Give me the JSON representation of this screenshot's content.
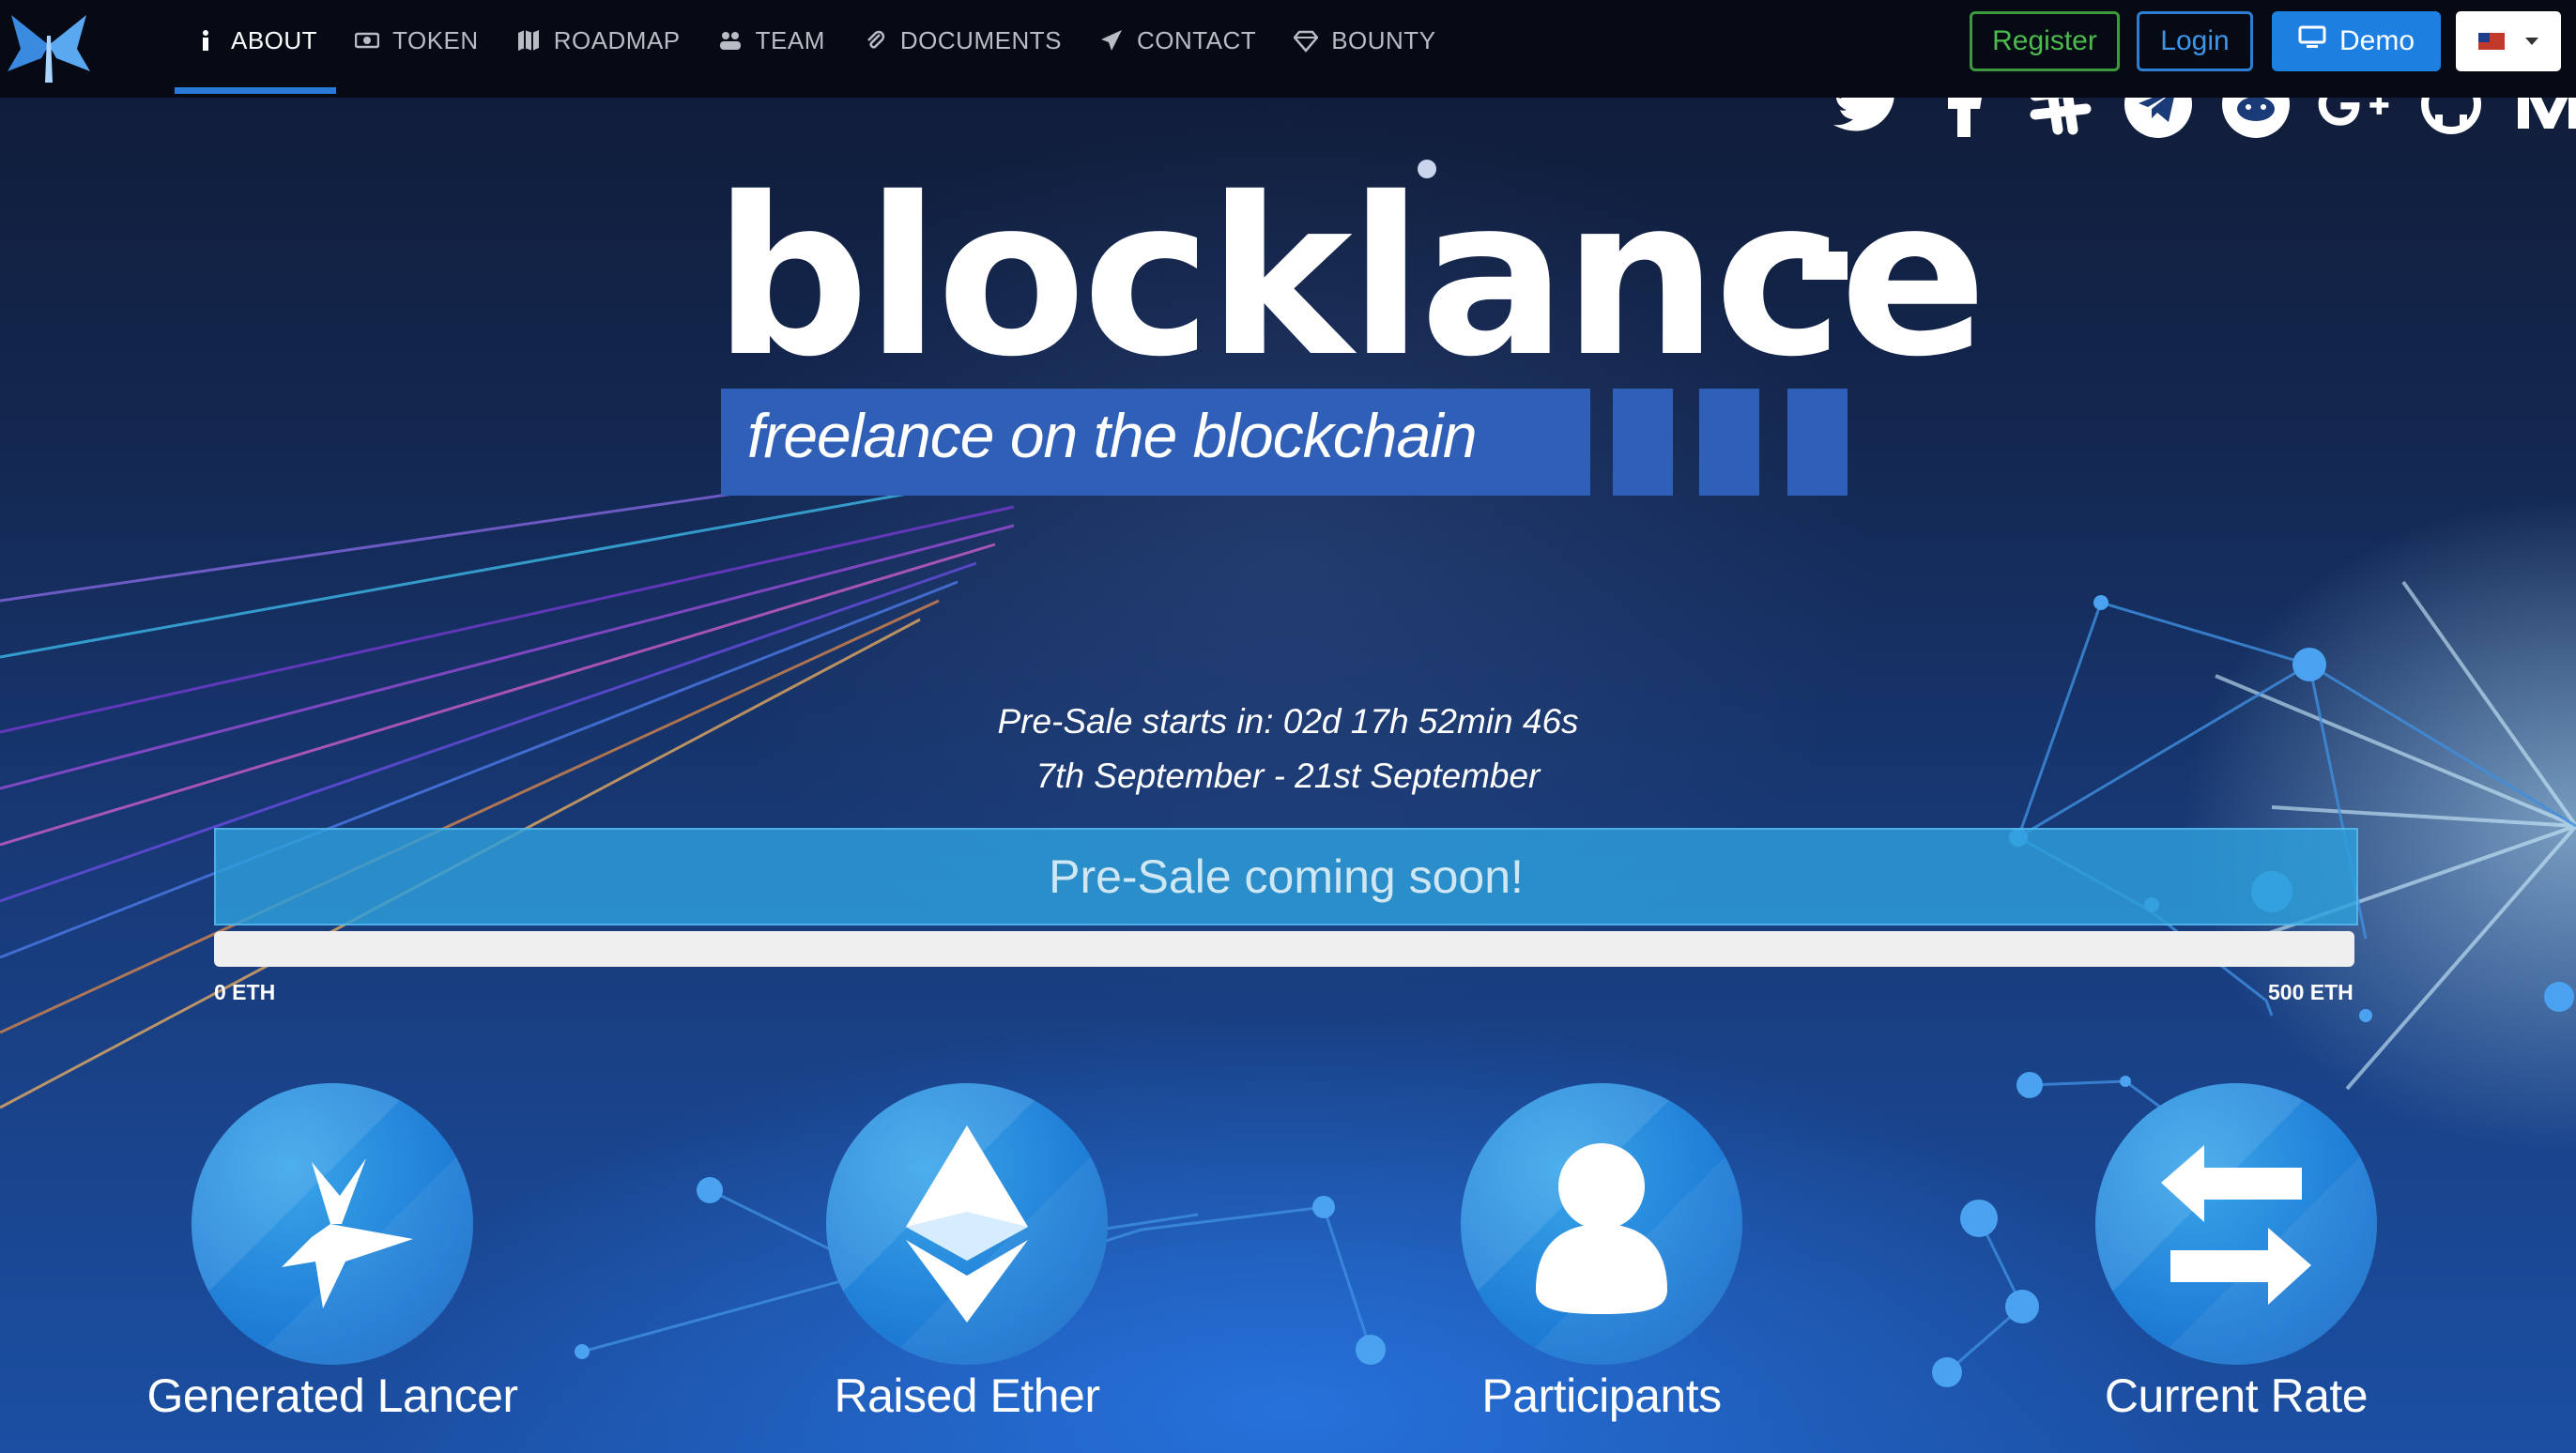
{
  "nav": {
    "items": [
      {
        "label": "ABOUT",
        "icon": "info-icon",
        "active": true
      },
      {
        "label": "TOKEN",
        "icon": "money-icon",
        "active": false
      },
      {
        "label": "ROADMAP",
        "icon": "map-icon",
        "active": false
      },
      {
        "label": "TEAM",
        "icon": "users-icon",
        "active": false
      },
      {
        "label": "DOCUMENTS",
        "icon": "paperclip-icon",
        "active": false
      },
      {
        "label": "CONTACT",
        "icon": "paper-plane-icon",
        "active": false
      },
      {
        "label": "BOUNTY",
        "icon": "diamond-icon",
        "active": false
      }
    ],
    "register_label": "Register",
    "login_label": "Login",
    "demo_label": "Demo",
    "language": "us-flag-icon"
  },
  "socials": [
    "twitter-icon",
    "facebook-icon",
    "slack-icon",
    "telegram-icon",
    "reddit-icon",
    "google-plus-icon",
    "github-icon",
    "medium-icon"
  ],
  "hero": {
    "brand": "blocklance",
    "tagline": "freelance on the blockchain",
    "countdown": "Pre-Sale starts in: 02d 17h 52min 46s",
    "dates": "7th September - 21st September"
  },
  "presale": {
    "banner": "Pre-Sale coming soon!",
    "progress": 0,
    "min_label": "0 ETH",
    "max_label": "500 ETH"
  },
  "stats": [
    {
      "label": "Generated Lancer",
      "icon": "butterfly-icon"
    },
    {
      "label": "Raised Ether",
      "icon": "ethereum-icon"
    },
    {
      "label": "Participants",
      "icon": "person-icon"
    },
    {
      "label": "Current Rate",
      "icon": "exchange-arrows-icon"
    }
  ],
  "colors": {
    "accent": "#1d7fe0",
    "register": "#3c9a3c",
    "tagline_bar": "#2f5fb7",
    "banner": "#2ea0dc"
  }
}
